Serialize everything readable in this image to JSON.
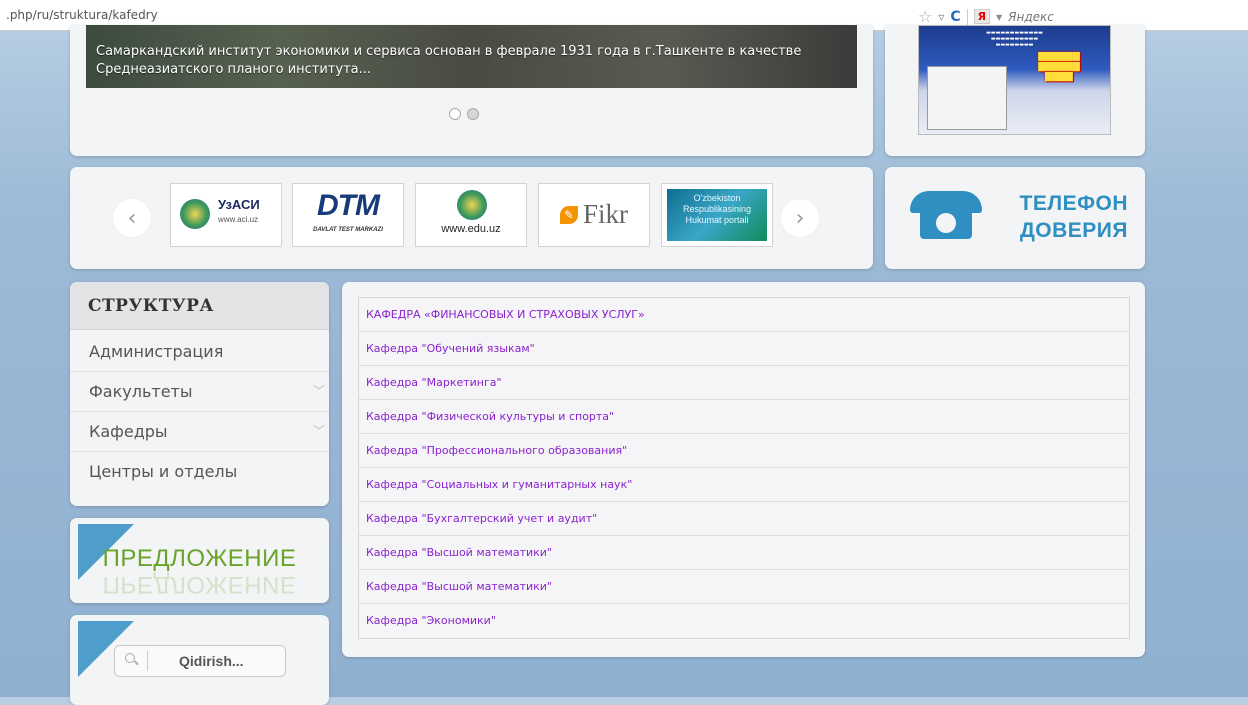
{
  "browser": {
    "url": ".php/ru/struktura/kafedry",
    "search_engine": "Яндекс",
    "yandex_label": "Я"
  },
  "slider": {
    "caption": "Самаркандский институт экономики и сервиса основан в феврале 1931 года в г.Ташкенте в качестве Среднеазиатского планого института...",
    "dots": 2,
    "active_dot": 2
  },
  "logos": [
    {
      "title": "УзАСИ",
      "sub": "www.aci.uz"
    },
    {
      "title": "DTM",
      "sub": "DAVLAT TEST MARKAZI"
    },
    {
      "title": "www.edu.uz"
    },
    {
      "title": "Fikr"
    },
    {
      "title": "O'zbekiston Respublikasining Hukumat portali"
    }
  ],
  "phone": {
    "line1": "ТЕЛЕФОН",
    "line2": "ДОВЕРИЯ"
  },
  "sidebar": {
    "heading": "СТРУКТУРА",
    "items": [
      {
        "label": "Администрация"
      },
      {
        "label": "Факультеты"
      },
      {
        "label": "Кафедры"
      },
      {
        "label": "Центры и отделы"
      }
    ]
  },
  "offer": {
    "label": "ПРЕДЛОЖЕНИЕ"
  },
  "search": {
    "label": "Qidirish..."
  },
  "departments": [
    "КАФЕДРА «ФИНАНСОВЫХ И СТРАХОВЫХ УСЛУГ»",
    "Кафедра \"Обучений языкам\"",
    "Кафедра \"Маркетинга\"",
    "Кафедра \"Физической культуры и спорта\"",
    "Кафедра \"Профессионального образования\"",
    "Кафедра \"Социальных и гуманитарных наук\"",
    "Кафедра \"Бухгалтерский учет и аудит\"",
    "Кафедра \"Высшой математики\"",
    "Кафедра \"Высшой математики\"",
    "Кафедра \"Экономики\""
  ],
  "colors": {
    "link": "#8a22cf",
    "phone_blue": "#2f8fc1",
    "offer_green": "#69a32a"
  }
}
